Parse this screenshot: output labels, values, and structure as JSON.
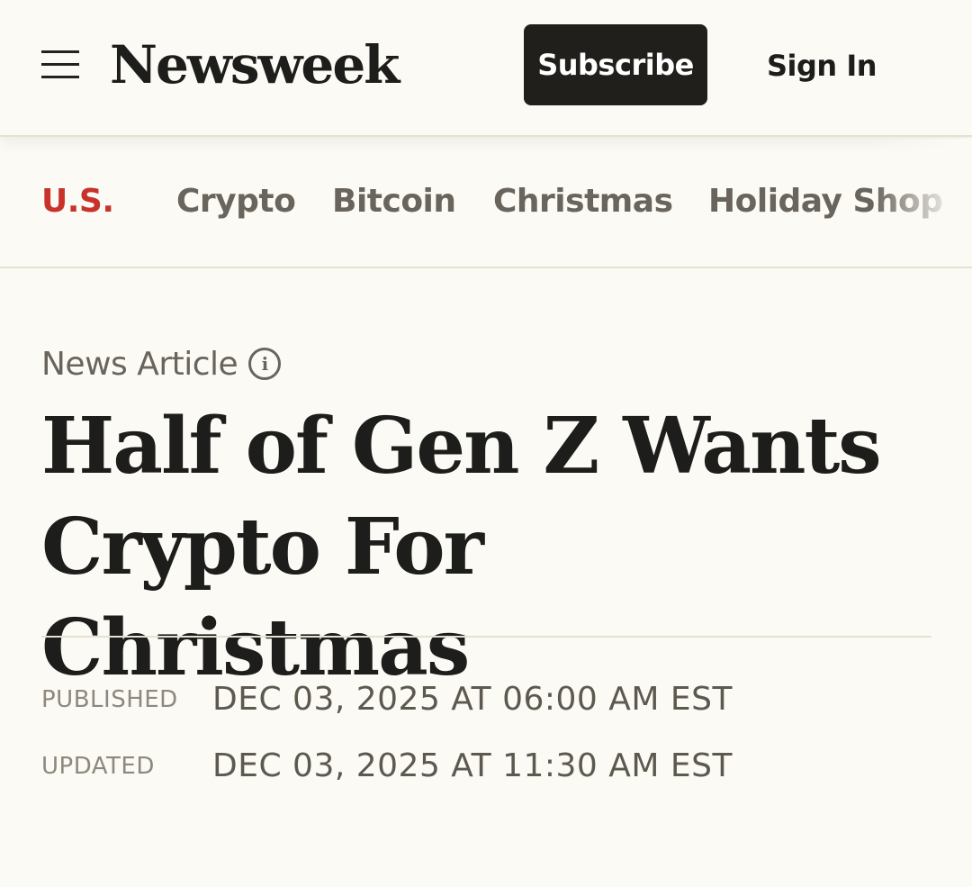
{
  "header": {
    "menu_icon": "hamburger-menu-icon",
    "logo_text": "Newsweek",
    "subscribe_label": "Subscribe",
    "signin_label": "Sign In"
  },
  "nav": {
    "items": [
      {
        "label": "U.S.",
        "active": true
      },
      {
        "label": "Crypto",
        "active": false
      },
      {
        "label": "Bitcoin",
        "active": false
      },
      {
        "label": "Christmas",
        "active": false
      },
      {
        "label": "Holiday Shop",
        "active": false
      }
    ]
  },
  "article": {
    "kicker": "News Article",
    "kicker_icon": "info-icon",
    "headline_line1": "Half of Gen Z Wants",
    "headline_line2": "Crypto For Christmas",
    "published_label": "PUBLISHED",
    "published_value": "DEC 03, 2025 AT 06:00 AM EST",
    "updated_label": "UPDATED",
    "updated_value": "DEC 03, 2025 AT 11:30 AM EST"
  },
  "colors": {
    "background": "#fbfaf5",
    "accent_red": "#c8322b",
    "button_dark": "#201f1b",
    "text_dark": "#1d1d1b",
    "text_muted": "#6a655c"
  }
}
